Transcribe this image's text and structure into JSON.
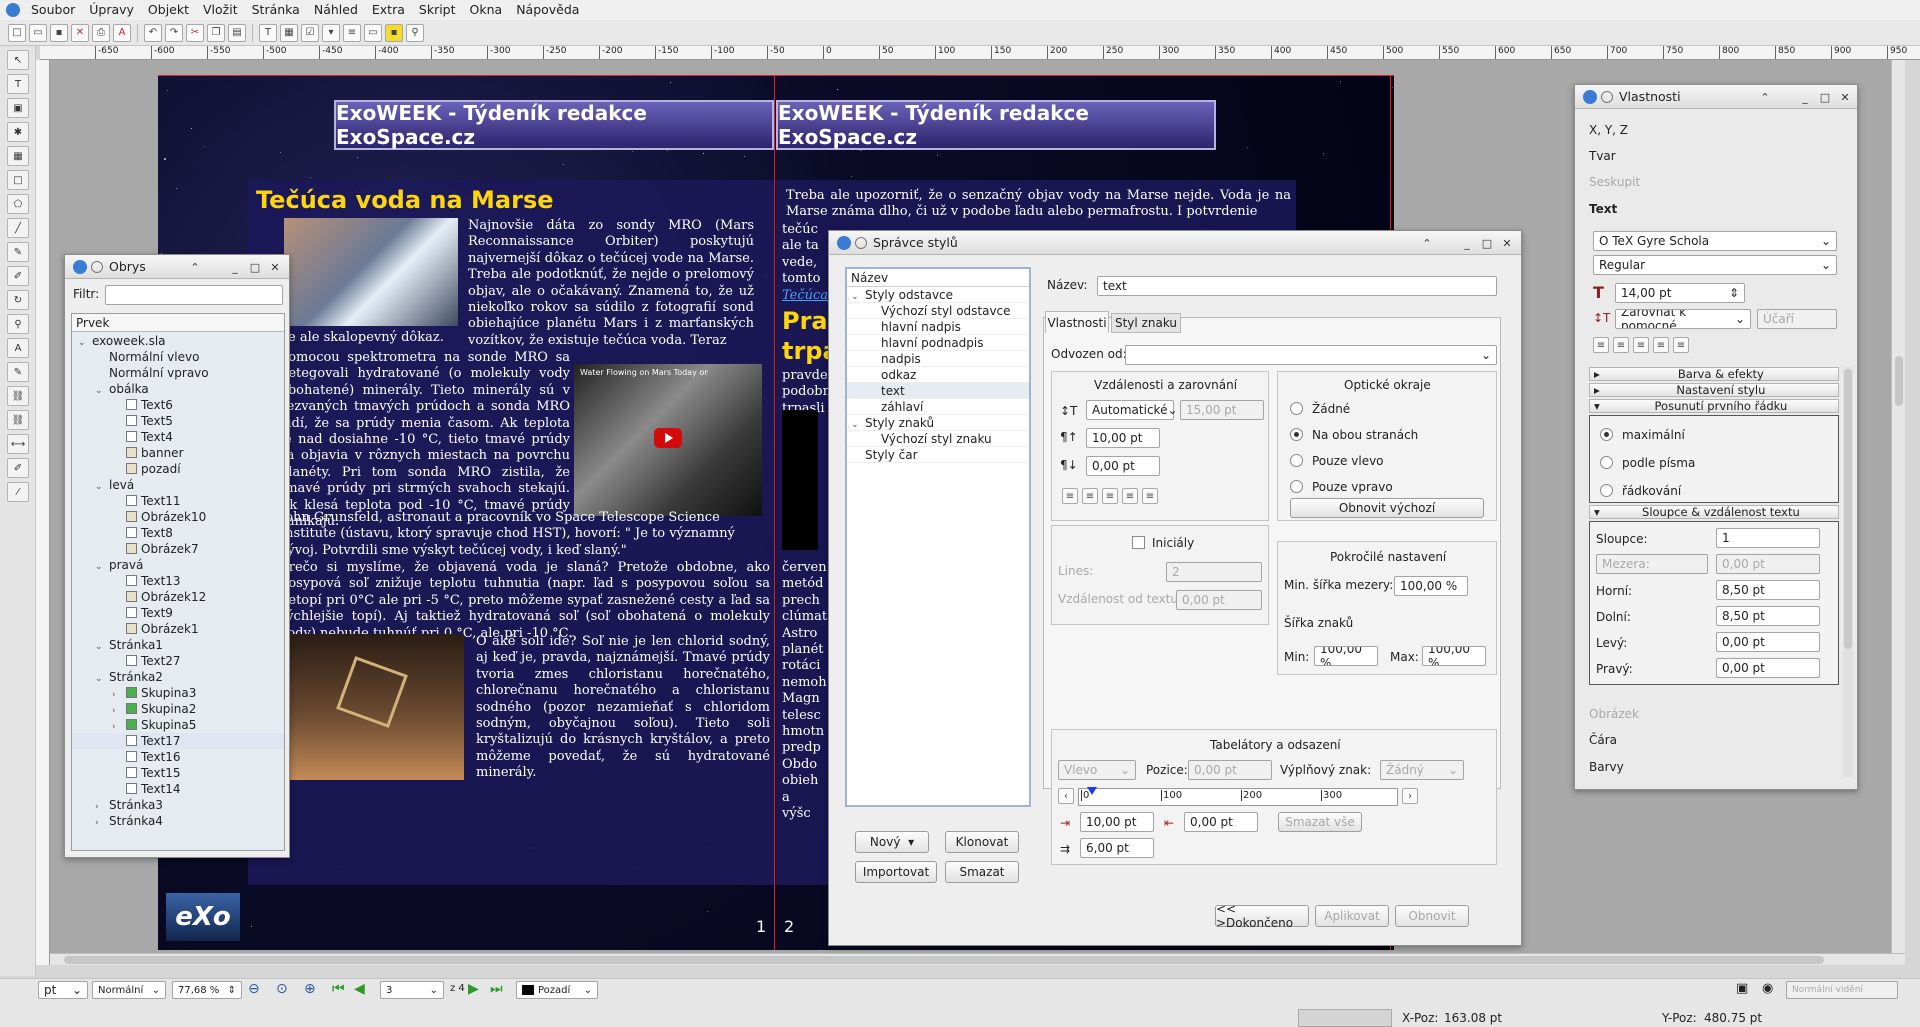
{
  "menu": [
    "Soubor",
    "Úpravy",
    "Objekt",
    "Vložit",
    "Stránka",
    "Náhled",
    "Extra",
    "Skript",
    "Okna",
    "Nápověda"
  ],
  "ruler_labels": [
    "-650",
    "-600",
    "-550",
    "-500",
    "-450",
    "-400",
    "-350",
    "-300",
    "-250",
    "-200",
    "-150",
    "-100",
    "-50",
    "0",
    "50",
    "100",
    "150",
    "200",
    "250",
    "300",
    "350",
    "400",
    "450",
    "500",
    "550",
    "600",
    "650",
    "700",
    "750",
    "800",
    "850",
    "900",
    "950"
  ],
  "document": {
    "banner_text": "ExoWEEK - Týdeník redakce ExoSpace.cz",
    "left_title": "Tečúca voda na Marse",
    "left_p1": "Najnovšie dáta zo sondy MRO (Mars Reconnaissance Orbiter) poskytujú najvernejší dôkaz o tečúcej vode na Marse. Treba ale podotknúť, že nejde o prelomový objav, ale o očakávaný. Znamená to, že už niekoľko rokov sa súdilo z fotografií sond obiehajúce planétu Mars i z marťanských vozítkov, že existuje tečúca voda. Teraz",
    "left_p1b": "je ale skalopevný dôkaz.",
    "left_p2": "Pomocou spektrometra na sonde MRO sa detegovali hydratované (o molekuly vody obohatené) minerály. Tieto minerály sú v sezvaných tmavých prúdoch a sonda MRO vidí, že sa prúdy menia časom. Ak teplota je nad dosiahne -10 °C, tieto tmavé prúdy sa objavia v rôznych miestach na povrchu planéty. Pri tom sonda MRO zistila, že tmavé prúdy pri strmých svahoch stekajú. Ak klesá teplota pod -10 °C, tmavé prúdy zanikajú.",
    "left_p3": "John Grunsfeld, astronaut a pracovník vo Space Telescope Science Institute (ústavu, ktorý spravuje chod HST), hovorí: \"  Je to významný vývoj. Potvrdili sme výskyt tečúcej vody, i keď slaný.\"",
    "left_p4": "Prečo si myslíme, že objavená voda je slaná? Pretože obdobne, ako posypová soľ znižuje teplotu tuhnutia (napr. ľad s posypovou soľou sa netopí pri 0°C ale pri -5 °C, preto môžeme sypať zasnežené cesty a ľad sa rýchlejšie topí). Aj taktiež hydratovaná soľ (soľ obohatená o molekuly vody) nebude tuhnúť pri 0 °C, ale pri -10 °C.",
    "left_p5": "O aké soli ide? Soľ nie je len chlorid sodný, aj keď je, pravda, najznámejší. Tmavé prúdy tvoria zmes chloristanu horečnatého, chlorečnanu horečnatého a chloristanu sodného (pozor nezamieňať s chloridom sodným, obyčajnou soľou). Tieto soli kryštalizujú do krásnych kryštálov, a preto môžeme povedať, že sú hydratované minerály.",
    "video_title": "Water Flowing on Mars Today on Thi...",
    "right_p1": "Treba ale upozorniť, že o senzačný objav vody na Marse nejde. Voda je na Marse známa dlho, či už v podobe ľadu alebo permafrostu. I potvrdenie",
    "right_lines": [
      "tečúc",
      "ale ta",
      "vede,",
      "tomto",
      "Tečúca"
    ],
    "right_title": [
      "Pra",
      "trpa"
    ],
    "right_small": [
      "pravde",
      "podobn",
      "trpasli"
    ],
    "right_lower": [
      "červen",
      "metód",
      "prech",
      "clúmat",
      "Astro",
      "planét",
      "rotáci",
      "nemoh",
      "Magn",
      "telesc",
      "hmotn",
      "predp",
      "Obdo",
      "obieh",
      "a výšc"
    ],
    "page_numbers": [
      "1",
      "2"
    ],
    "logo_text": "eXo"
  },
  "outline": {
    "title": "Obrys",
    "filter_label": "Filtr:",
    "filter_value": "",
    "column": "Prvek",
    "items": [
      {
        "label": "exoweek.sla",
        "depth": 0,
        "exp": "v",
        "icon": ""
      },
      {
        "label": "Normální vlevo",
        "depth": 1,
        "exp": "",
        "icon": ""
      },
      {
        "label": "Normální vpravo",
        "depth": 1,
        "exp": "",
        "icon": ""
      },
      {
        "label": "obálka",
        "depth": 1,
        "exp": "v",
        "icon": ""
      },
      {
        "label": "Text6",
        "depth": 2,
        "exp": "",
        "icon": "text"
      },
      {
        "label": "Text5",
        "depth": 2,
        "exp": "",
        "icon": "text"
      },
      {
        "label": "Text4",
        "depth": 2,
        "exp": "",
        "icon": "text"
      },
      {
        "label": "banner",
        "depth": 2,
        "exp": "",
        "icon": "image"
      },
      {
        "label": "pozadí",
        "depth": 2,
        "exp": "",
        "icon": "image"
      },
      {
        "label": "levá",
        "depth": 1,
        "exp": "v",
        "icon": ""
      },
      {
        "label": "Text11",
        "depth": 2,
        "exp": "",
        "icon": "text"
      },
      {
        "label": "Obrázek10",
        "depth": 2,
        "exp": "",
        "icon": "image"
      },
      {
        "label": "Text8",
        "depth": 2,
        "exp": "",
        "icon": "text"
      },
      {
        "label": "Obrázek7",
        "depth": 2,
        "exp": "",
        "icon": "image"
      },
      {
        "label": "pravá",
        "depth": 1,
        "exp": "v",
        "icon": ""
      },
      {
        "label": "Text13",
        "depth": 2,
        "exp": "",
        "icon": "text"
      },
      {
        "label": "Obrázek12",
        "depth": 2,
        "exp": "",
        "icon": "image"
      },
      {
        "label": "Text9",
        "depth": 2,
        "exp": "",
        "icon": "text"
      },
      {
        "label": "Obrázek1",
        "depth": 2,
        "exp": "",
        "icon": "image"
      },
      {
        "label": "Stránka1",
        "depth": 1,
        "exp": "v",
        "icon": ""
      },
      {
        "label": "Text27",
        "depth": 2,
        "exp": "",
        "icon": "text"
      },
      {
        "label": "Stránka2",
        "depth": 1,
        "exp": "v",
        "icon": ""
      },
      {
        "label": "Skupina3",
        "depth": 2,
        "exp": ">",
        "icon": "group"
      },
      {
        "label": "Skupina2",
        "depth": 2,
        "exp": ">",
        "icon": "group"
      },
      {
        "label": "Skupina5",
        "depth": 2,
        "exp": ">",
        "icon": "group"
      },
      {
        "label": "Text17",
        "depth": 2,
        "exp": "",
        "icon": "text",
        "selected": true
      },
      {
        "label": "Text16",
        "depth": 2,
        "exp": "",
        "icon": "text"
      },
      {
        "label": "Text15",
        "depth": 2,
        "exp": "",
        "icon": "text"
      },
      {
        "label": "Text14",
        "depth": 2,
        "exp": "",
        "icon": "text"
      },
      {
        "label": "Stránka3",
        "depth": 1,
        "exp": ">",
        "icon": ""
      },
      {
        "label": "Stránka4",
        "depth": 1,
        "exp": ">",
        "icon": ""
      }
    ]
  },
  "styles": {
    "title": "Správce stylů",
    "tree_header": "Název",
    "tree": [
      {
        "label": "Styly odstavce",
        "depth": 0,
        "exp": "v"
      },
      {
        "label": "Výchozí styl odstavce",
        "depth": 1,
        "exp": ""
      },
      {
        "label": "hlavní nadpis",
        "depth": 1,
        "exp": ""
      },
      {
        "label": "hlavní podnadpis",
        "depth": 1,
        "exp": ""
      },
      {
        "label": "nadpis",
        "depth": 1,
        "exp": ""
      },
      {
        "label": "odkaz",
        "depth": 1,
        "exp": ""
      },
      {
        "label": "text",
        "depth": 1,
        "exp": "",
        "selected": true
      },
      {
        "label": "záhlaví",
        "depth": 1,
        "exp": ""
      },
      {
        "label": "Styly znaků",
        "depth": 0,
        "exp": "v"
      },
      {
        "label": "Výchozí styl znaku",
        "depth": 1,
        "exp": ""
      },
      {
        "label": "Styly čar",
        "depth": 0,
        "exp": ""
      }
    ],
    "btn_new": "Nový",
    "btn_clone": "Klonovat",
    "btn_import": "Importovat",
    "btn_delete": "Smazat",
    "name_label": "Název:",
    "name_value": "text",
    "tab_props": "Vlastnosti",
    "tab_char": "Styl znaku",
    "derived_label": "Odvozen od:",
    "derived_value": "",
    "spacing_title": "Vzdálenosti a zarovnání",
    "linespacing_mode": "Automatické",
    "linespacing_value": "15,00 pt",
    "space_above": "10,00 pt",
    "space_below": "0,00 pt",
    "optical_title": "Optické okraje",
    "opt_none": "Žádné",
    "opt_both": "Na obou stranách",
    "opt_left": "Pouze vlevo",
    "opt_right": "Pouze vpravo",
    "reset_default": "Obnovit výchozí",
    "dropcaps": "Iniciály",
    "lines_label": "Lines:",
    "lines_value": "2",
    "dist_label": "Vzdálenost od textu",
    "dist_value": "0,00 pt",
    "advanced_title": "Pokročilé nastavení",
    "min_space_label": "Min. šířka mezery:",
    "min_space_value": "100,00 %",
    "glyph_width_label": "Šířka znaků",
    "min_label": "Min:",
    "min_value": "100,00 %",
    "max_label": "Max:",
    "max_value": "100,00 %",
    "tabs_title": "Tabelátory a odsazení",
    "tab_align": "Vlevo",
    "pos_label": "Pozice:",
    "pos_value": "0,00 pt",
    "fill_label": "Výplňový znak:",
    "fill_value": "Žádný",
    "ruler_marks": [
      "0",
      "100",
      "200",
      "300"
    ],
    "indent_left": "10,00 pt",
    "indent_right": "0,00 pt",
    "indent_first": "6,00 pt",
    "delete_all": "Smazat vše",
    "btn_done": "<< >Dokončeno",
    "btn_apply": "Aplikovat",
    "btn_reset": "Obnovit"
  },
  "props": {
    "title": "Vlastnosti",
    "sections": [
      "X, Y, Z",
      "Tvar",
      "Seskupit",
      "Text"
    ],
    "font": "TeX Gyre Schola",
    "font_style": "Regular",
    "font_size": "14,00 pt",
    "baseline": "Zarovnat k pomocné",
    "baseline_extra": "Účaří",
    "collapsed": [
      "Barva & efekty",
      "Nastavení stylu"
    ],
    "first_line_header": "Posunutí prvního řádku",
    "first_line_opts": [
      "maximální",
      "podle písma",
      "řádkování"
    ],
    "columns_header": "Sloupce & vzdálenost textu",
    "columns_label": "Sloupce:",
    "columns_value": "1",
    "gap_mode": "Mezera:",
    "gap_value": "0,00 pt",
    "top_label": "Horní:",
    "top_value": "8,50 pt",
    "bottom_label": "Dolní:",
    "bottom_value": "8,50 pt",
    "left_label": "Levý:",
    "left_value": "0,00 pt",
    "right_label": "Pravý:",
    "right_value": "0,00 pt",
    "bottom_sections": [
      "Obrázek",
      "Čára",
      "Barvy"
    ]
  },
  "status": {
    "unit": "pt",
    "mode": "Normální",
    "zoom": "77,68 %",
    "page": "3",
    "page_of": "z 4",
    "layer": "Pozadí",
    "view_mode": "Normální vidění",
    "xpos_label": "X-Poz:",
    "xpos": "163.08 pt",
    "ypos_label": "Y-Poz:",
    "ypos": "480.75 pt"
  }
}
